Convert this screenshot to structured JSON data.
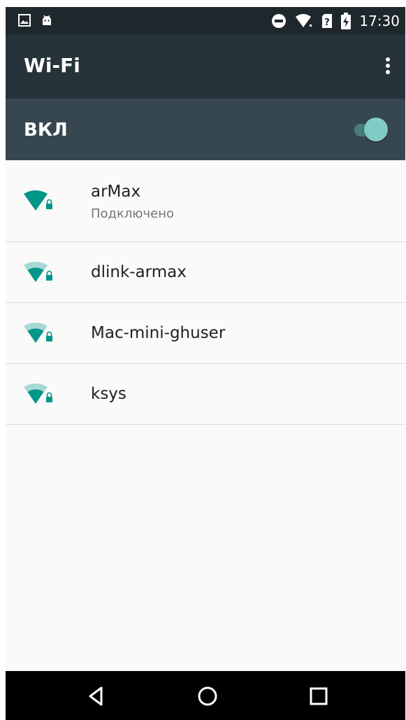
{
  "status_bar": {
    "time": "17:30",
    "left_icons": [
      "image-notification-icon",
      "android-notification-icon"
    ],
    "right_icons": [
      "do-not-disturb-icon",
      "wifi-signal-icon",
      "no-sim-icon",
      "battery-charging-icon"
    ]
  },
  "toolbar": {
    "title": "Wi-Fi",
    "more_icon": "more-vert-icon"
  },
  "master_switch": {
    "label": "ВКЛ",
    "state": "on"
  },
  "networks": [
    {
      "ssid": "arMax",
      "status": "Подключено",
      "signal": "full",
      "secured": true
    },
    {
      "ssid": "dlink-armax",
      "signal": "medium",
      "secured": true
    },
    {
      "ssid": "Mac-mini-ghuser",
      "signal": "medium",
      "secured": true
    },
    {
      "ssid": "ksys",
      "signal": "medium",
      "secured": true
    }
  ],
  "nav_bar": {
    "buttons": [
      "back-icon",
      "home-icon",
      "recents-icon"
    ]
  },
  "colors": {
    "status_bar": "#1e272c",
    "toolbar": "#27333a",
    "master_bar": "#37474f",
    "accent": "#009688",
    "switch_thumb": "#80cbc4",
    "background": "#fafafa"
  }
}
